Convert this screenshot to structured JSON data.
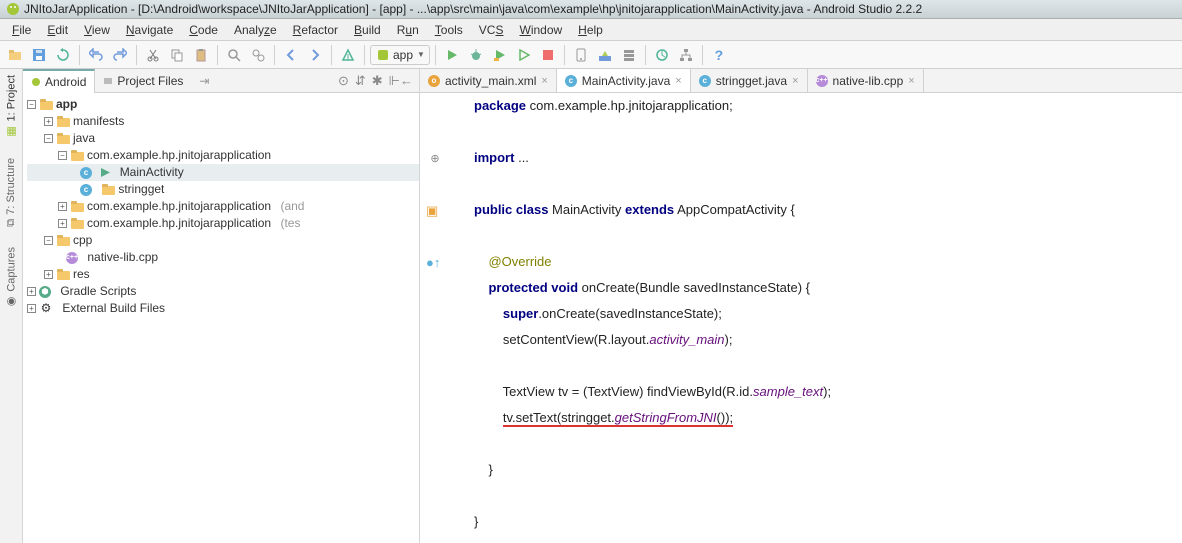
{
  "title": "JNItoJarApplication - [D:\\Android\\workspace\\JNItoJarApplication] - [app] - ...\\app\\src\\main\\java\\com\\example\\hp\\jnitojarapplication\\MainActivity.java - Android Studio 2.2.2",
  "menu": [
    "File",
    "Edit",
    "View",
    "Navigate",
    "Code",
    "Analyze",
    "Refactor",
    "Build",
    "Run",
    "Tools",
    "VCS",
    "Window",
    "Help"
  ],
  "toolbar": {
    "combo": "app"
  },
  "side_tabs": {
    "project": "1: Project",
    "structure": "7: Structure",
    "captures": "Captures"
  },
  "panel": {
    "tab_android": "Android",
    "tab_files": "Project Files"
  },
  "tree": {
    "app": "app",
    "manifests": "manifests",
    "java": "java",
    "pkg1": "com.example.hp.jnitojarapplication",
    "main_activity": "MainActivity",
    "stringget": "stringget",
    "pkg2": "com.example.hp.jnitojarapplication",
    "pkg2_suf": "(and",
    "pkg3": "com.example.hp.jnitojarapplication",
    "pkg3_suf": "(tes",
    "cpp": "cpp",
    "native": "native-lib.cpp",
    "res": "res",
    "gradle": "Gradle Scripts",
    "external": "External Build Files"
  },
  "editor_tabs": {
    "t1": "activity_main.xml",
    "t2": "MainActivity.java",
    "t3": "stringget.java",
    "t4": "native-lib.cpp"
  },
  "code": {
    "pkg_kw": "package",
    "pkg": "com.example.hp.jnitojarapplication;",
    "imp_kw": "import",
    "imp": "...",
    "pub": "public class",
    "cls": "MainActivity",
    "ext": "extends",
    "sup": "AppCompatActivity {",
    "override": "@Override",
    "prot": "protected void",
    "on": "onCreate(Bundle savedInstanceState) {",
    "s1a": "super",
    "s1b": ".onCreate(savedInstanceState);",
    "s2a": "setContentView(R.layout.",
    "s2b": "activity_main",
    "s2c": ");",
    "s3a": "TextView tv = (TextView) findViewById(R.id.",
    "s3b": "sample_text",
    "s3c": ");",
    "s4a": "tv.setText(stringget.",
    "s4b": "getStringFromJNI",
    "s4c": "());",
    "cb": "}"
  }
}
